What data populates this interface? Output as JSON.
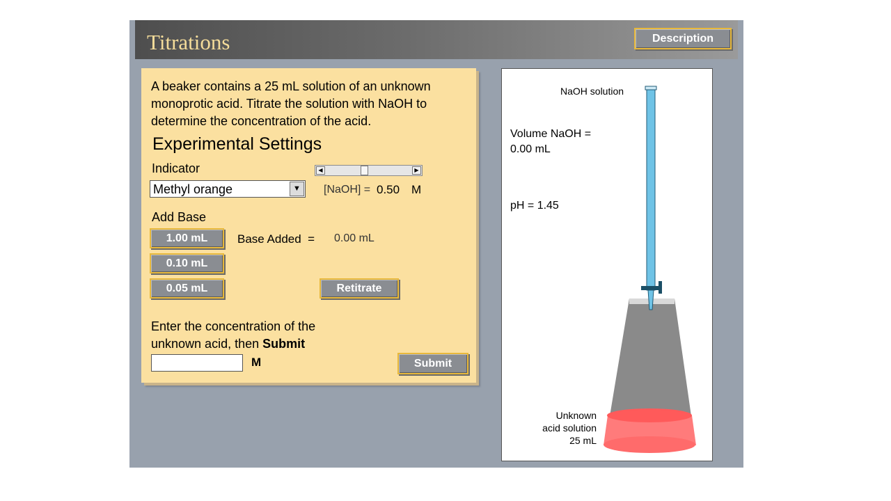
{
  "app": {
    "title": "Titrations",
    "description_button": "Description"
  },
  "panel": {
    "intro": "A beaker contains a 25 mL solution of an unknown monoprotic acid.  Titrate the solution with NaOH to determine the concentration of the acid.",
    "settings_heading": "Experimental Settings",
    "indicator_label": "Indicator",
    "indicator_value": "Methyl orange",
    "naoh_label": "[NaOH] =",
    "naoh_value": "0.50",
    "naoh_unit": "M",
    "add_base_label": "Add Base",
    "add_buttons": [
      "1.00 mL",
      "0.10 mL",
      "0.05 mL"
    ],
    "base_added_label": "Base Added  =",
    "base_added_value": "0.00 mL",
    "retitrate_button": "Retitrate",
    "prompt_line1": "Enter the concentration of the",
    "prompt_line2_plain": "unknown acid, then ",
    "prompt_line2_bold": "Submit",
    "input_unit": "M",
    "input_value": "",
    "submit_button": "Submit",
    "slider_level": 0.45
  },
  "view": {
    "burette_label": "NaOH solution",
    "volume_line1": "Volume NaOH =",
    "volume_line2": "0.00 mL",
    "ph_text": "pH = 1.45",
    "flask_line1": "Unknown",
    "flask_line2": "acid solution",
    "flask_line3": "25 mL"
  },
  "colors": {
    "panel_bg": "#fbe0a0",
    "app_bg": "#98a1ad",
    "title": "#f4dc9a",
    "button_border": "#e8b83a",
    "solution": "#ff6b6b",
    "burette": "#6fc3e6"
  }
}
